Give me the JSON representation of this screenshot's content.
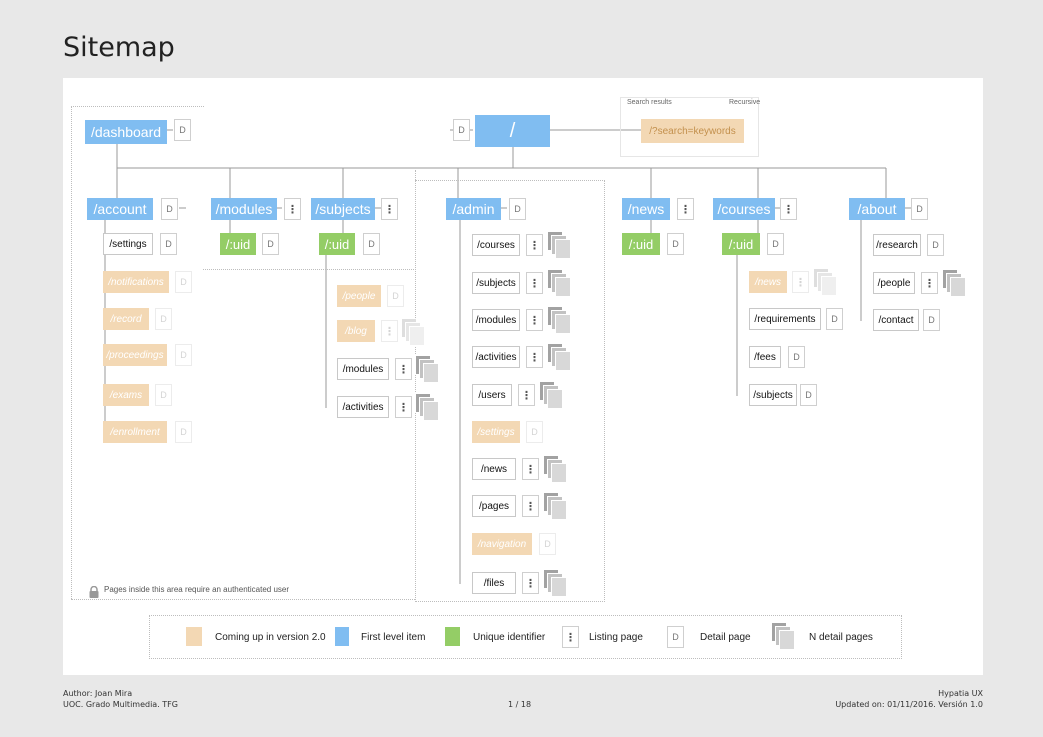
{
  "page_title": "Sitemap",
  "search": {
    "results_label": "Search results",
    "recursive_label": "Recursive",
    "node": "/?search=keywords"
  },
  "root": "/",
  "dashboard": "/dashboard",
  "d": "D",
  "dots": "⋮",
  "uid": "/:uid",
  "account": {
    "label": "/account",
    "children": [
      "/settings",
      "/notifications",
      "/record",
      "/proceedings",
      "/exams",
      "/enrollment"
    ]
  },
  "modules": {
    "label": "/modules"
  },
  "subjects": {
    "label": "/subjects",
    "children": [
      "/people",
      "/blog",
      "/modules",
      "/activities"
    ]
  },
  "admin": {
    "label": "/admin",
    "children": [
      "/courses",
      "/subjects",
      "/modules",
      "/activities",
      "/users",
      "/settings",
      "/news",
      "/pages",
      "/navigation",
      "/files"
    ]
  },
  "news": {
    "label": "/news"
  },
  "courses": {
    "label": "/courses",
    "children": [
      "/news",
      "/requirements",
      "/fees",
      "/subjects"
    ]
  },
  "about": {
    "label": "/about",
    "children": [
      "/research",
      "/people",
      "/contact"
    ]
  },
  "auth_note": "Pages inside this area require an authenticated user",
  "legend": {
    "coming": "Coming up in version 2.0",
    "first_level": "First level item",
    "unique_id": "Unique identifier",
    "listing": "Listing page",
    "detail": "Detail page",
    "n_detail": "N detail pages"
  },
  "footer": {
    "author": "Author: Joan Mira",
    "org": "UOC. Grado Multimedia. TFG",
    "page": "1 / 18",
    "brand": "Hypatia UX",
    "updated": "Updated on: 01/11/2016. Versión 1.0"
  },
  "colors": {
    "first_level": "#80bdf1",
    "unique_id": "#94cd66",
    "coming": "#f3d8b4"
  }
}
